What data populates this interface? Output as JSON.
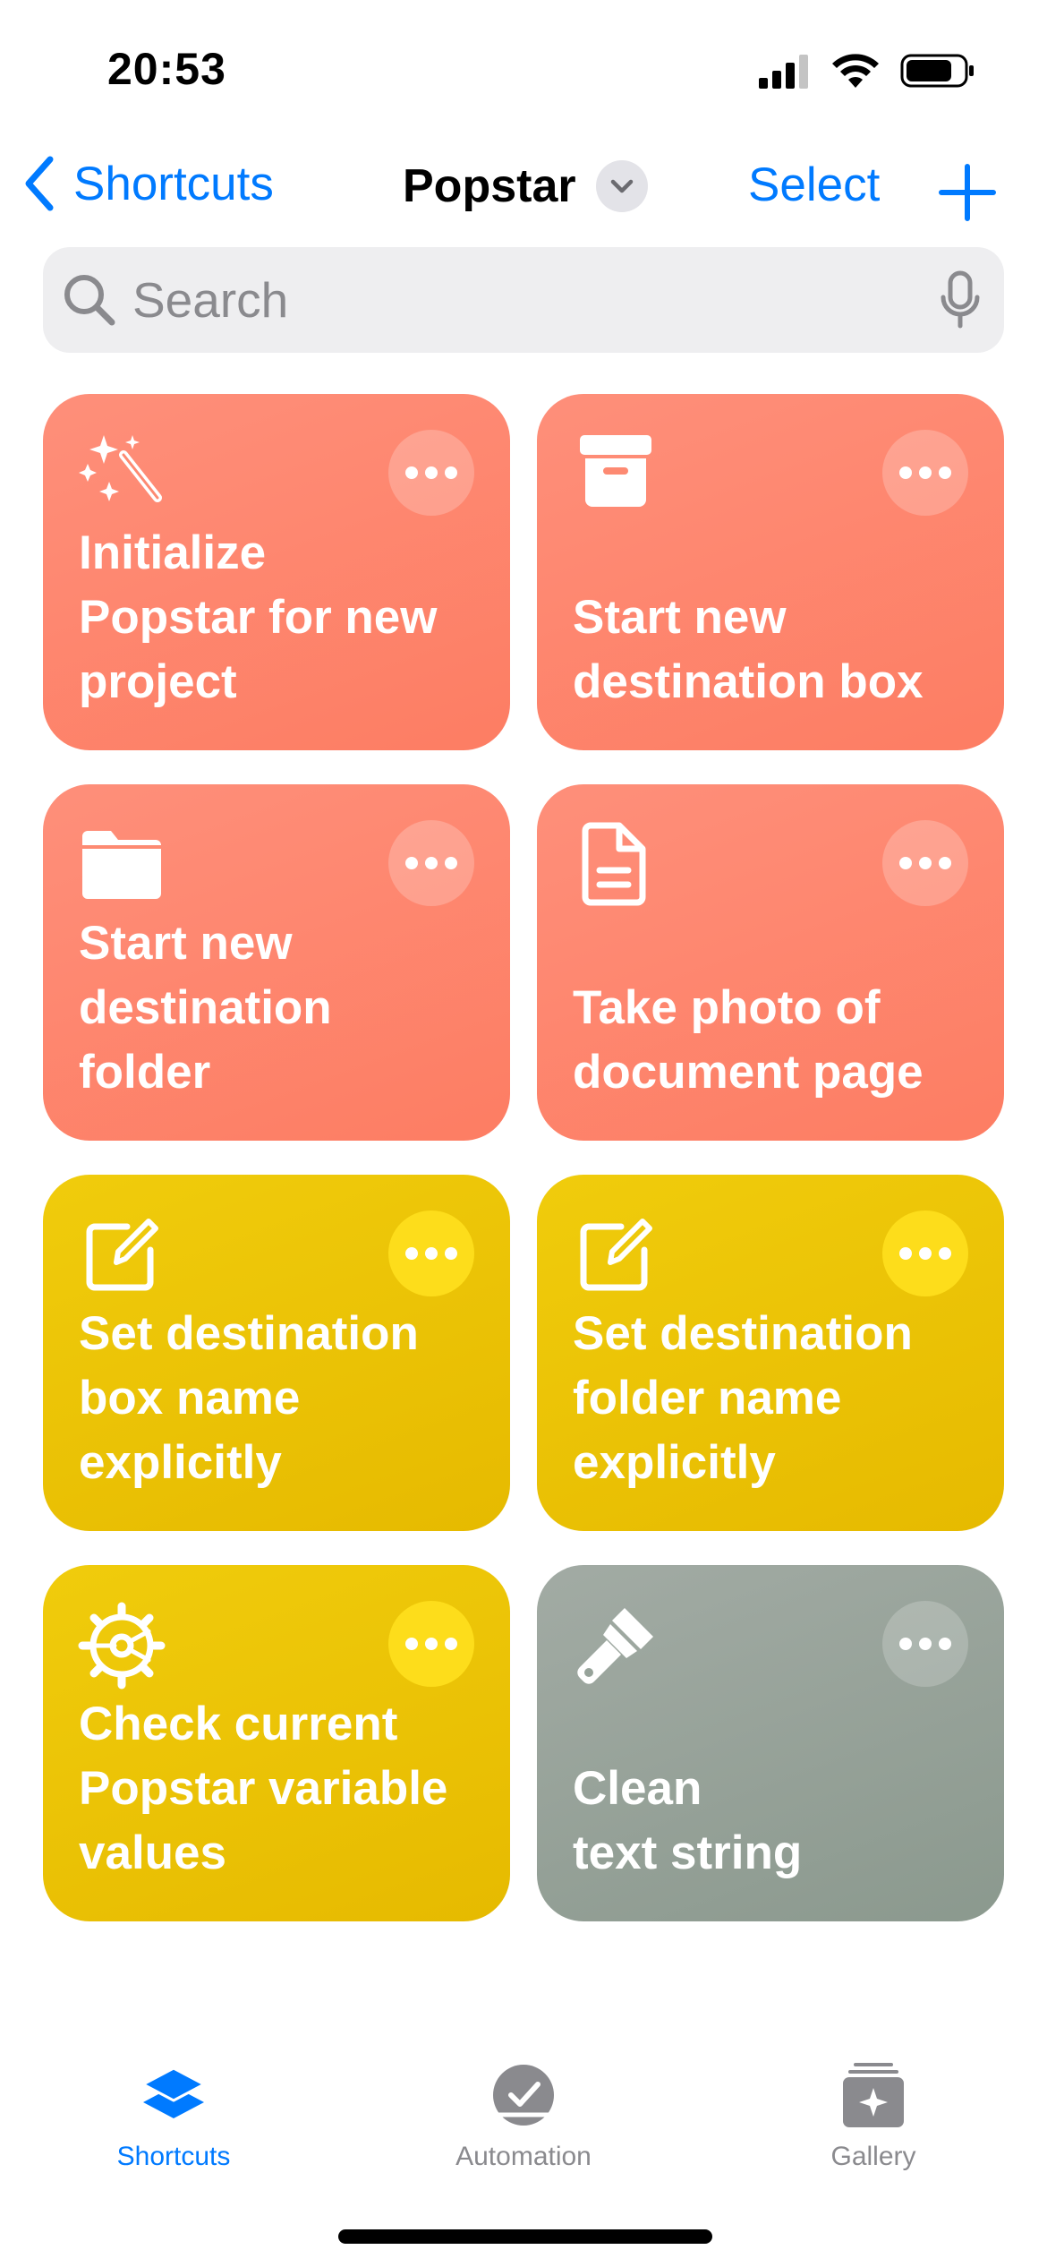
{
  "status_bar": {
    "time": "20:53"
  },
  "nav": {
    "back_label": "Shortcuts",
    "title": "Popstar",
    "select_label": "Select"
  },
  "search": {
    "placeholder": "Search"
  },
  "shortcuts": [
    {
      "label": "Initialize\nPopstar for new\nproject",
      "color": "#fd8a72",
      "icon": "magic-wand-icon"
    },
    {
      "label": "Start new\ndestination box",
      "color": "#fd8a72",
      "icon": "archive-box-icon"
    },
    {
      "label": "Start new\ndestination\nfolder",
      "color": "#fd8a72",
      "icon": "folder-icon"
    },
    {
      "label": "Take photo of\ndocument page",
      "color": "#fd8a72",
      "icon": "document-icon"
    },
    {
      "label": "Set destination\nbox name\nexplicitly",
      "color": "#eac305",
      "icon": "compose-icon"
    },
    {
      "label": "Set destination\nfolder name\nexplicitly",
      "color": "#eac305",
      "icon": "compose-icon"
    },
    {
      "label": "Check current\nPopstar variable\nvalues",
      "color": "#eac305",
      "icon": "gear-icon"
    },
    {
      "label": "Clean\ntext string",
      "color": "#97a39a",
      "icon": "paintbrush-icon"
    }
  ],
  "tab_bar": {
    "tabs": [
      {
        "label": "Shortcuts",
        "icon": "stack-icon",
        "active": true
      },
      {
        "label": "Automation",
        "icon": "clock-check-icon",
        "active": false
      },
      {
        "label": "Gallery",
        "icon": "gallery-icon",
        "active": false
      }
    ]
  },
  "colors": {
    "accent": "#007aff",
    "coral": "#fd8a72",
    "yellow": "#eac305",
    "gray": "#97a39a"
  }
}
